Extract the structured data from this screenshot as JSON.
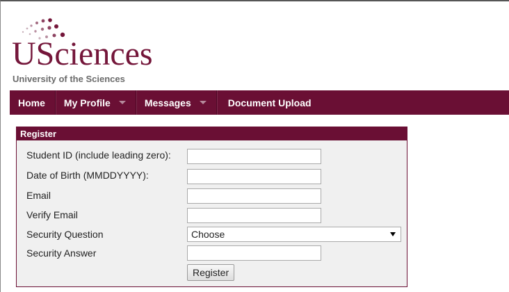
{
  "logo": {
    "wordmark_u": "U",
    "wordmark_rest": "Sciences",
    "subtitle": "University of the Sciences"
  },
  "nav": {
    "items": [
      {
        "label": "Home"
      },
      {
        "label": "My Profile"
      },
      {
        "label": "Messages"
      },
      {
        "label": "Document Upload"
      }
    ]
  },
  "register": {
    "title": "Register",
    "fields": {
      "student_id": {
        "label": "Student ID (include leading zero):",
        "value": ""
      },
      "dob": {
        "label": "Date of Birth (MMDDYYYY):",
        "value": ""
      },
      "email": {
        "label": "Email",
        "value": ""
      },
      "verify_email": {
        "label": "Verify Email",
        "value": ""
      },
      "security_question": {
        "label": "Security Question",
        "selected": "Choose"
      },
      "security_answer": {
        "label": "Security Answer",
        "value": ""
      }
    },
    "submit_label": "Register"
  },
  "colors": {
    "brand": "#6a0f34",
    "panel_bg": "#f0f0f0"
  }
}
